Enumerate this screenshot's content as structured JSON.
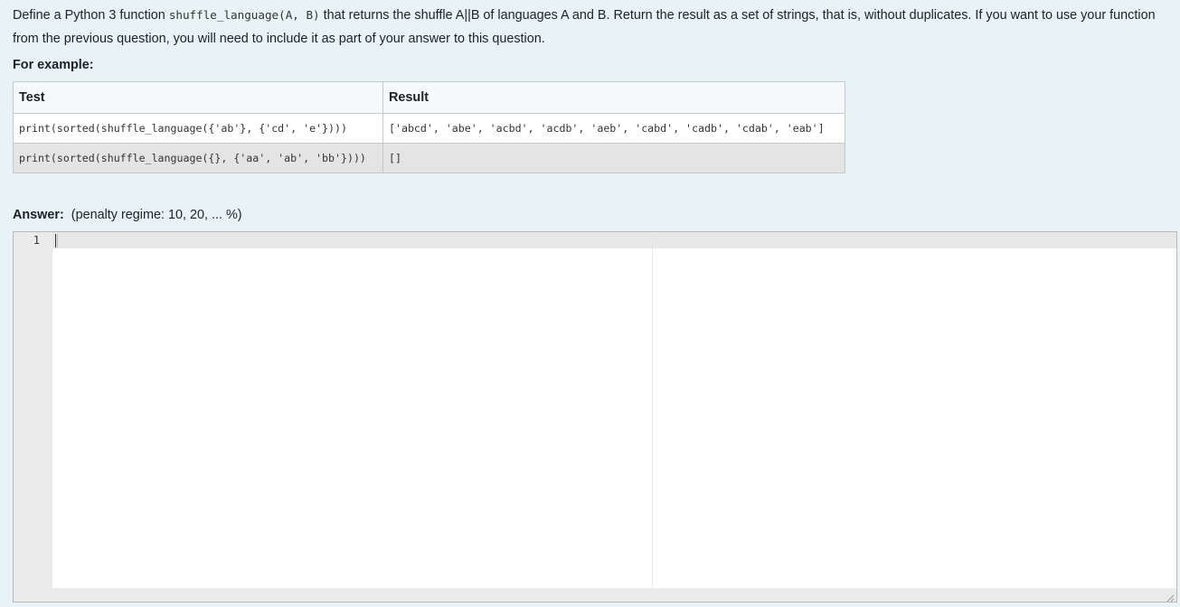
{
  "question": {
    "text_before": "Define a Python 3 function ",
    "function_code": "shuffle_language(A, B)",
    "text_after": " that returns the shuffle A||B of languages A and B. Return the result as a set of strings, that is, without duplicates. If you want to use your function from the previous question, you will need to include it as part of your answer to this question."
  },
  "examples": {
    "heading": "For example:",
    "headers": [
      "Test",
      "Result"
    ],
    "rows": [
      {
        "test": "print(sorted(shuffle_language({'ab'}, {'cd', 'e'})))",
        "result": "['abcd', 'abe', 'acbd', 'acdb', 'aeb', 'cabd', 'cadb', 'cdab', 'eab']"
      },
      {
        "test": "print(sorted(shuffle_language({}, {'aa', 'ab', 'bb'})))",
        "result": "[]"
      }
    ]
  },
  "answer": {
    "label": "Answer:",
    "penalty": "(penalty regime: 10, 20, ... %)",
    "line_numbers": [
      "1"
    ],
    "code": ""
  },
  "icons": {
    "resize": "resize-grip-icon"
  }
}
